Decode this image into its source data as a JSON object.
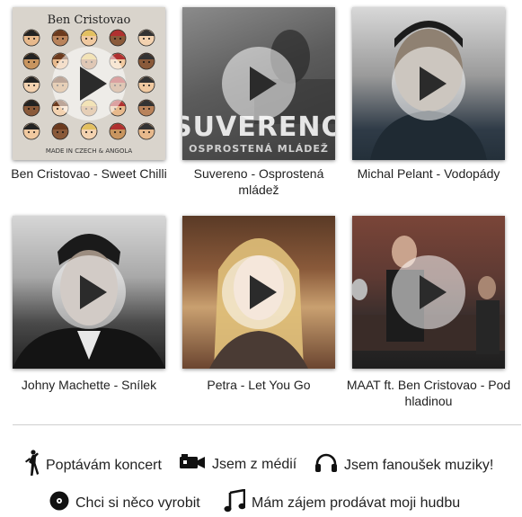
{
  "videos": [
    {
      "title": "Ben Cristovao - Sweet Chilli",
      "art_text": "Ben Cristovao",
      "art_footer": "MADE IN CZECH & ANGOLA"
    },
    {
      "title": "Suvereno - Osprostená mládež",
      "art_text": "SUVERENO",
      "art_subtext": "OSPROSTENÁ MLÁDEŽ"
    },
    {
      "title": "Michal Pelant - Vodopády"
    },
    {
      "title": "Johny Machette - Snílek"
    },
    {
      "title": "Petra - Let You Go"
    },
    {
      "title": "MAAT ft. Ben Cristovao - Pod hladinou"
    }
  ],
  "links": {
    "concert": {
      "label": "Poptávám koncert",
      "icon": "dancer-icon"
    },
    "media": {
      "label": "Jsem z médií",
      "icon": "video-camera-icon"
    },
    "fan": {
      "label": "Jsem fanoušek muziky!",
      "icon": "headphones-icon"
    },
    "produce": {
      "label": "Chci si něco vyrobit",
      "icon": "vinyl-icon"
    },
    "sell": {
      "label": "Mám zájem prodávat moji hudbu",
      "icon": "music-note-icon"
    }
  }
}
